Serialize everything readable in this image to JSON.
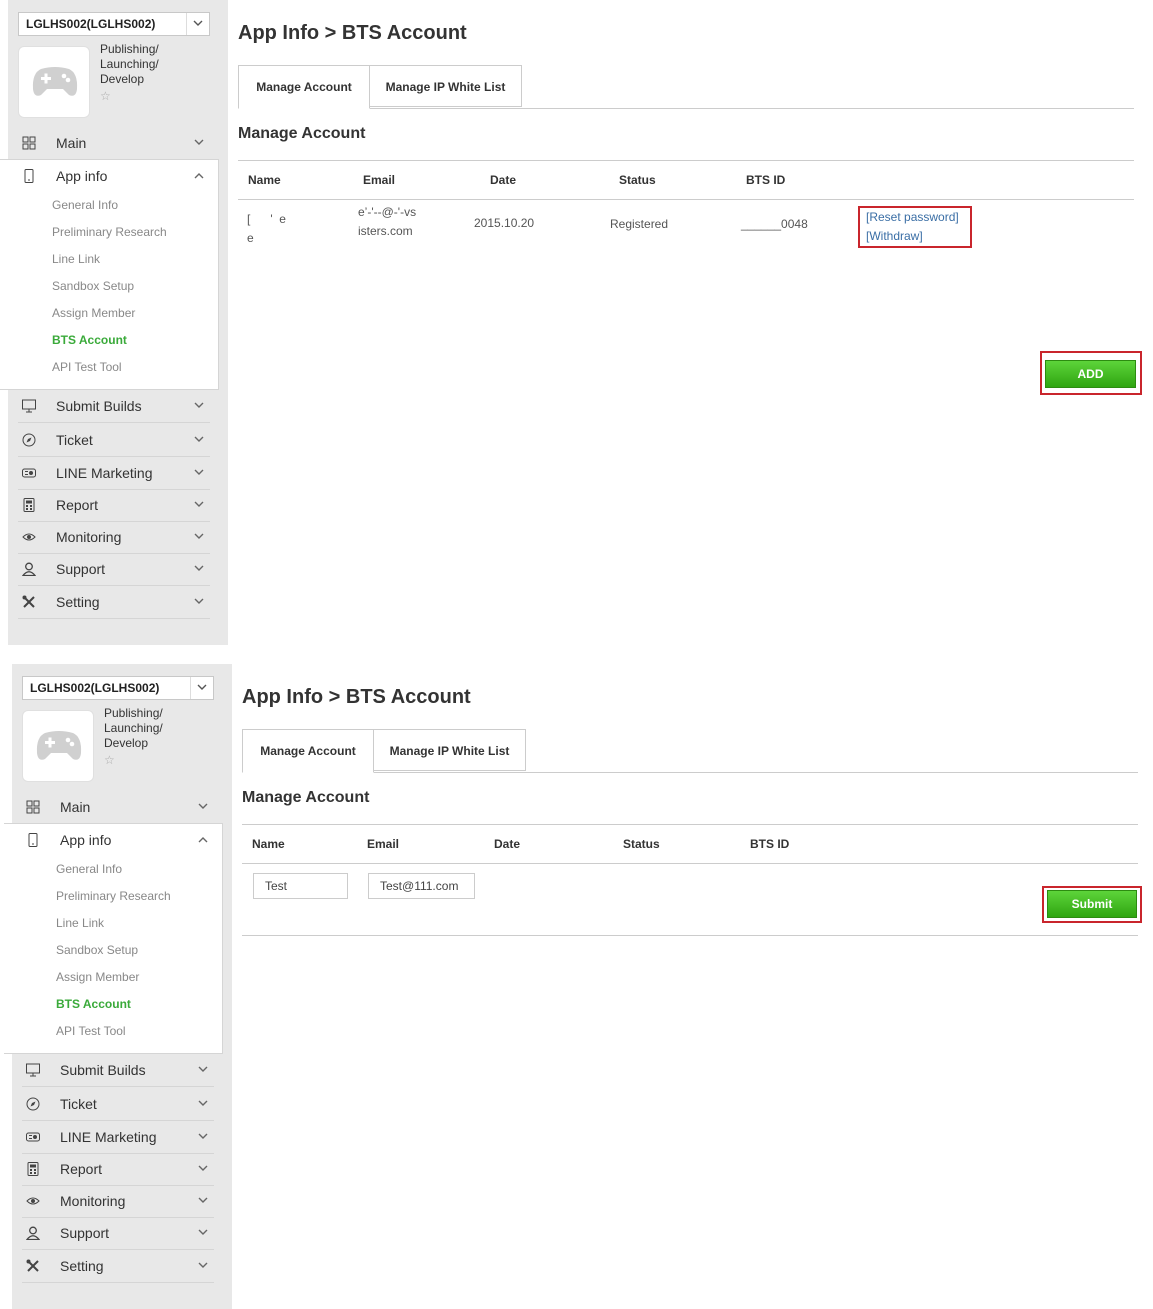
{
  "sidebar": {
    "app_selector": "LGLHS002(LGLHS002)",
    "app_status": [
      "Publishing/",
      "Launching/",
      "Develop"
    ],
    "star": "☆",
    "nav": [
      {
        "label": "Main",
        "icon": "grid-icon"
      },
      {
        "label": "App info",
        "icon": "mobile-icon"
      },
      {
        "label": "Submit Builds",
        "icon": "monitor-icon"
      },
      {
        "label": "Ticket",
        "icon": "compass-icon"
      },
      {
        "label": "LINE Marketing",
        "icon": "megaphone-icon"
      },
      {
        "label": "Report",
        "icon": "calculator-icon"
      },
      {
        "label": "Monitoring",
        "icon": "eye-icon"
      },
      {
        "label": "Support",
        "icon": "person-icon"
      },
      {
        "label": "Setting",
        "icon": "tools-icon"
      }
    ],
    "app_info_subitems": [
      {
        "label": "General Info"
      },
      {
        "label": "Preliminary Research"
      },
      {
        "label": "Line Link"
      },
      {
        "label": "Sandbox Setup"
      },
      {
        "label": "Assign Member"
      },
      {
        "label": "BTS Account",
        "active": true
      },
      {
        "label": "API Test Tool"
      }
    ]
  },
  "page": {
    "title": "App Info > BTS Account",
    "tabs": [
      "Manage Account",
      "Manage IP White List"
    ],
    "section_title": "Manage Account"
  },
  "table": {
    "headers": [
      "Name",
      "Email",
      "Date",
      "Status",
      "BTS ID"
    ],
    "row": {
      "name_line1": "[      '  e",
      "name_line2": "e",
      "email_line1": "e’-'--@-'-vs",
      "email_line2": "isters.com",
      "date": "2015.10.20",
      "status": "Registered",
      "bts_id": "______0048",
      "reset_link": "[Reset password]",
      "withdraw_link": "[Withdraw]"
    }
  },
  "buttons": {
    "add": "ADD",
    "submit": "Submit"
  },
  "form": {
    "name_value": "Test",
    "email_value": "Test@111.com"
  },
  "colors": {
    "active_green": "#3aaa3a",
    "highlight_red": "#c9252c",
    "button_green": "#3cc41a"
  }
}
